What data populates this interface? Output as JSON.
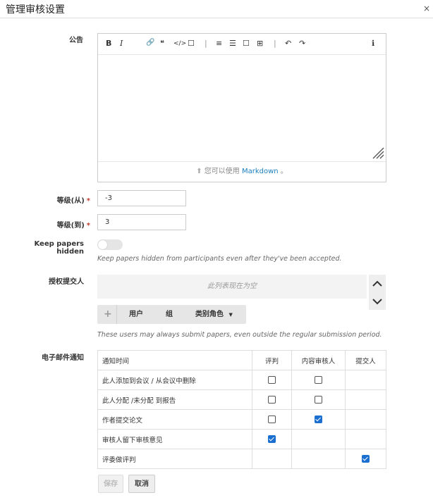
{
  "dialog": {
    "title": "管理审核设置",
    "close_glyph": "×"
  },
  "announcement": {
    "label": "公告",
    "toolbar": [
      {
        "name": "bold-icon",
        "glyph": "B"
      },
      {
        "name": "italic-icon",
        "glyph": "I"
      },
      {
        "name": "link-icon",
        "glyph": "🔗"
      },
      {
        "name": "quote-icon",
        "glyph": "❝"
      },
      {
        "name": "code-icon",
        "glyph": "</>"
      },
      {
        "name": "image-icon",
        "glyph": "☐"
      },
      {
        "name": "ordered-list-icon",
        "glyph": "≡"
      },
      {
        "name": "unordered-list-icon",
        "glyph": "☰"
      },
      {
        "name": "table-icon",
        "glyph": "☐"
      },
      {
        "name": "table-insert-icon",
        "glyph": "⊞"
      },
      {
        "name": "undo-icon",
        "glyph": "↶"
      },
      {
        "name": "redo-icon",
        "glyph": "↷"
      },
      {
        "name": "info-icon",
        "glyph": "ℹ"
      }
    ],
    "markdown_prefix": "您可以使用",
    "markdown_link": "Markdown",
    "markdown_suffix": "。"
  },
  "rank_from": {
    "label": "等级(从)",
    "value": "-3"
  },
  "rank_to": {
    "label": "等级(到)",
    "value": "3"
  },
  "required_mark": "*",
  "keep_hidden": {
    "label": "Keep papers hidden",
    "enabled": false,
    "hint": "Keep papers hidden from participants even after they've been accepted."
  },
  "authorized_submitters": {
    "label": "授权提交人",
    "empty_text": "此列表现在为空",
    "buttons": {
      "add": "+",
      "user": "用户",
      "group": "组",
      "category_role": "类别角色"
    },
    "hint": "These users may always submit papers, even outside the regular submission period."
  },
  "email_notifications": {
    "label": "电子邮件通知",
    "headers": [
      "通知时间",
      "评判",
      "内容审核人",
      "提交人"
    ],
    "rows": [
      {
        "label": "此人添加到会议 / 从会议中删除",
        "judge": false,
        "reviewer": false,
        "submitter": null
      },
      {
        "label": "此人分配 /未分配 到报告",
        "judge": false,
        "reviewer": false,
        "submitter": null
      },
      {
        "label": "作者提交论文",
        "judge": false,
        "reviewer": true,
        "submitter": null
      },
      {
        "label": "审核人留下审核意见",
        "judge": true,
        "reviewer": null,
        "submitter": null
      },
      {
        "label": "评委做评判",
        "judge": null,
        "reviewer": null,
        "submitter": true
      }
    ]
  },
  "actions": {
    "save": "保存",
    "cancel": "取消"
  },
  "colors": {
    "accent": "#1a6fd0",
    "required": "#c0392b",
    "link": "#1a7fbd"
  }
}
